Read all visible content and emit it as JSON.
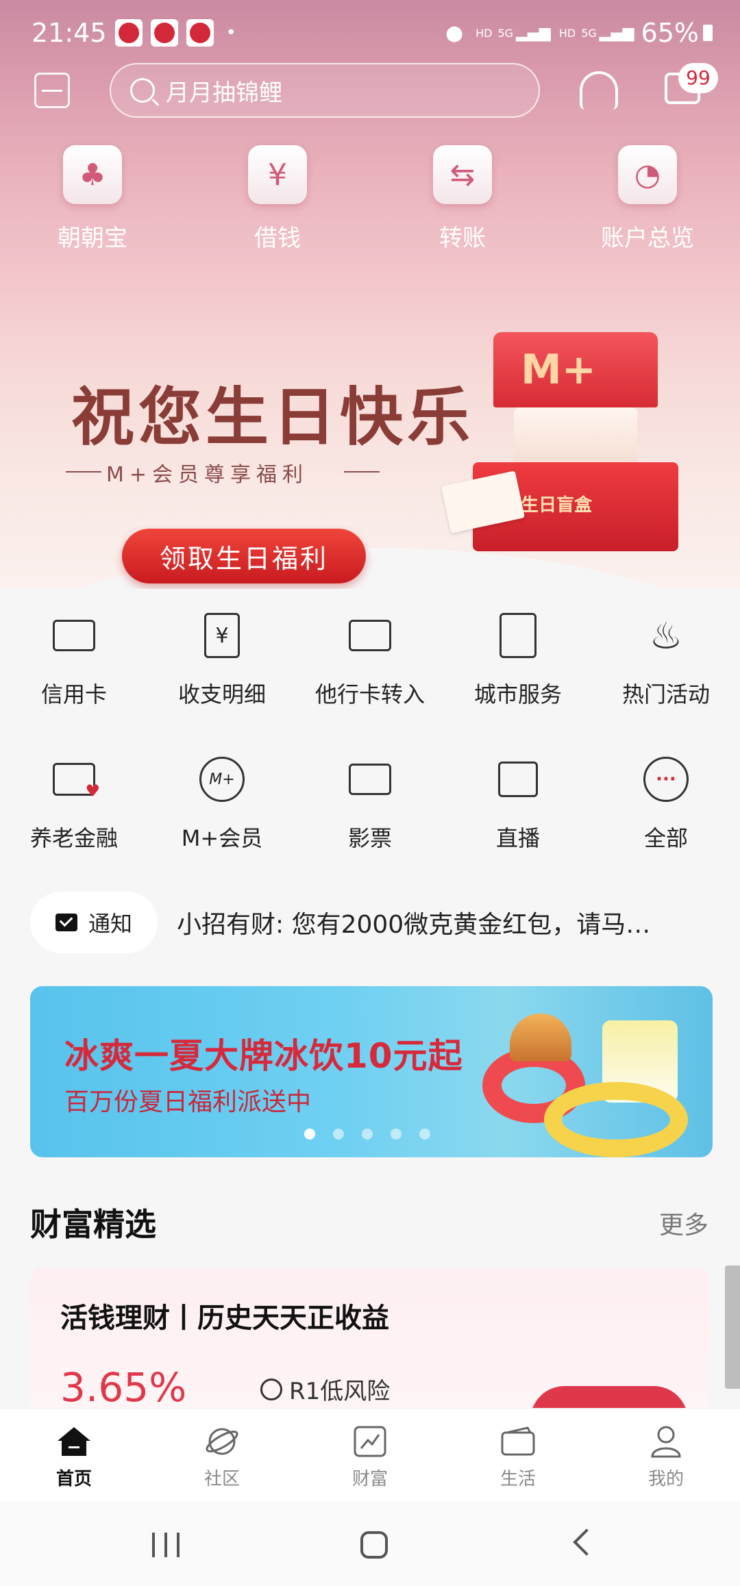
{
  "status_bar": {
    "time": "21:45",
    "dot": "•",
    "hd1": "HD",
    "net1": "5G",
    "hd2": "HD",
    "net2": "5G",
    "battery": "65%"
  },
  "header": {
    "search_placeholder": "月月抽锦鲤",
    "message_badge": "99",
    "icons": [
      "scan-icon",
      "search-icon",
      "headset-icon",
      "message-icon"
    ]
  },
  "quick_actions": [
    {
      "label": "朝朝宝",
      "icon": "money-bag-icon",
      "glyph": "♣"
    },
    {
      "label": "借钱",
      "icon": "yuan-coin-icon",
      "glyph": "¥"
    },
    {
      "label": "转账",
      "icon": "transfer-icon",
      "glyph": "⇆"
    },
    {
      "label": "账户总览",
      "icon": "pie-icon",
      "glyph": "◔"
    }
  ],
  "banner": {
    "title": "祝您生日快乐",
    "subtitle": "M+会员尊享福利",
    "cta": "领取生日福利",
    "gift_logo": "M+",
    "gift_label": "生日盲盒"
  },
  "service_grid": {
    "rows": [
      [
        {
          "label": "信用卡",
          "icon": "credit-card-icon"
        },
        {
          "label": "收支明细",
          "icon": "receipt-icon"
        },
        {
          "label": "他行卡转入",
          "icon": "card-transfer-in-icon"
        },
        {
          "label": "城市服务",
          "icon": "city-building-icon"
        },
        {
          "label": "热门活动",
          "icon": "flame-icon"
        }
      ],
      [
        {
          "label": "养老金融",
          "icon": "pension-card-icon"
        },
        {
          "label": "M+会员",
          "icon": "m-plus-icon"
        },
        {
          "label": "影票",
          "icon": "ticket-icon"
        },
        {
          "label": "直播",
          "icon": "tv-icon"
        },
        {
          "label": "全部",
          "icon": "more-dots-icon"
        }
      ]
    ],
    "receipt_glyph": "¥",
    "mplus_glyph": "M+",
    "more_glyph": "···"
  },
  "notice": {
    "label": "通知",
    "text": "小招有财: 您有2000微克黄金红包，请马…"
  },
  "promo": {
    "title": "冰爽一夏大牌冰饮10元起",
    "subtitle": "百万份夏日福利派送中",
    "dots_total": 5,
    "active_dot": 1
  },
  "wealth": {
    "title": "财富精选",
    "more": "更多",
    "card": {
      "title": "活钱理财丨历史天天正收益",
      "rate": "3.65%",
      "risk": "R1低风险"
    }
  },
  "tabbar": [
    {
      "label": "首页",
      "icon": "home-icon",
      "active": true
    },
    {
      "label": "社区",
      "icon": "planet-icon",
      "active": false
    },
    {
      "label": "财富",
      "icon": "chart-up-icon",
      "active": false
    },
    {
      "label": "生活",
      "icon": "ticket-life-icon",
      "active": false
    },
    {
      "label": "我的",
      "icon": "profile-icon",
      "active": false
    }
  ],
  "colors": {
    "brand_red": "#d3283a",
    "promo_red": "#d62a3c",
    "rate_red": "#e0384b",
    "promo_blue": "#57c3ec"
  }
}
